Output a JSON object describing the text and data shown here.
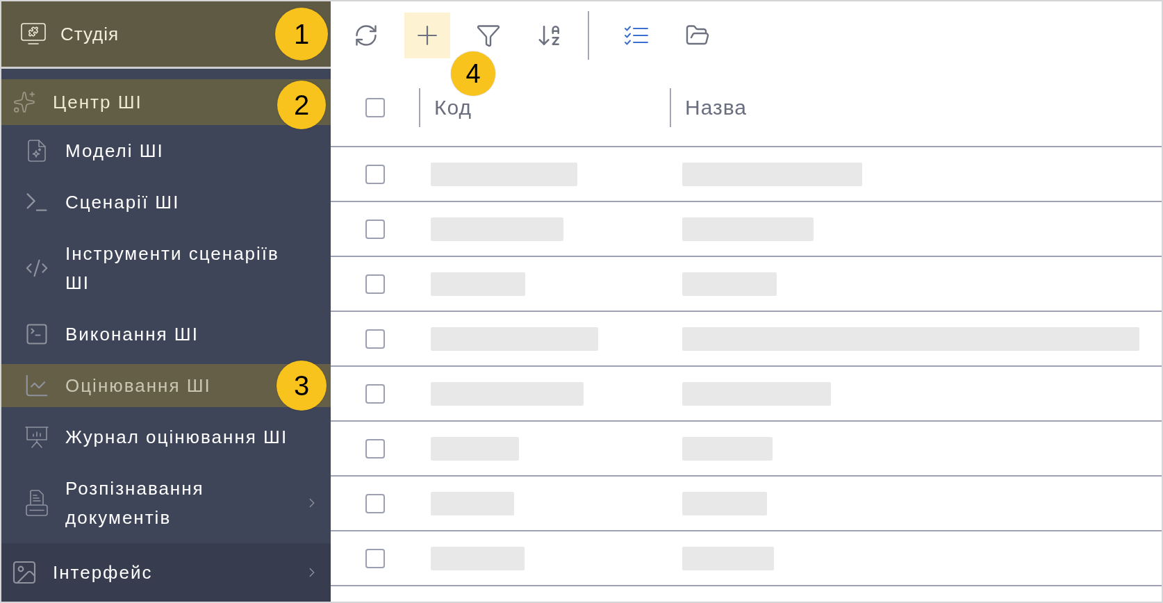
{
  "sidebar": {
    "header": {
      "label": "Студія",
      "selected": true,
      "callout": "1"
    },
    "sections": [
      {
        "label": "Центр ШІ",
        "selected": true,
        "expanded": true,
        "callout": "2",
        "children": [
          {
            "label": "Моделі ШІ",
            "selected": false
          },
          {
            "label": "Сценарії ШІ",
            "selected": false
          },
          {
            "label": "Інструменти сценаріїв ШІ",
            "selected": false
          },
          {
            "label": "Виконання ШІ",
            "selected": false
          },
          {
            "label": "Оцінювання ШІ",
            "selected": true,
            "callout": "3"
          },
          {
            "label": "Журнал оцінювання ШІ",
            "selected": false
          },
          {
            "label": "Розпізнавання документів",
            "selected": false,
            "expanded": false
          }
        ]
      },
      {
        "label": "Інтерфейс",
        "selected": false,
        "expanded": false
      }
    ]
  },
  "toolbar": [
    {
      "kind": "refresh",
      "hovered": false,
      "active": false
    },
    {
      "kind": "add",
      "hovered": true,
      "active": false,
      "callout": "4"
    },
    {
      "kind": "filter",
      "hovered": false,
      "active": false
    },
    {
      "kind": "sort",
      "hovered": false,
      "active": false
    },
    {
      "kind": "divider"
    },
    {
      "kind": "checklist",
      "hovered": false,
      "active": true
    },
    {
      "kind": "folder",
      "hovered": false,
      "active": false
    }
  ],
  "table": {
    "select_all": {
      "checked": false
    },
    "columns": [
      {
        "label": "Код"
      },
      {
        "label": "Назва"
      }
    ],
    "rows": [
      {
        "checked": false,
        "loading": true
      },
      {
        "checked": false,
        "loading": true
      },
      {
        "checked": false,
        "loading": true
      },
      {
        "checked": false,
        "loading": true
      },
      {
        "checked": false,
        "loading": true
      },
      {
        "checked": false,
        "loading": true
      },
      {
        "checked": false,
        "loading": true
      },
      {
        "checked": false,
        "loading": true
      }
    ]
  }
}
